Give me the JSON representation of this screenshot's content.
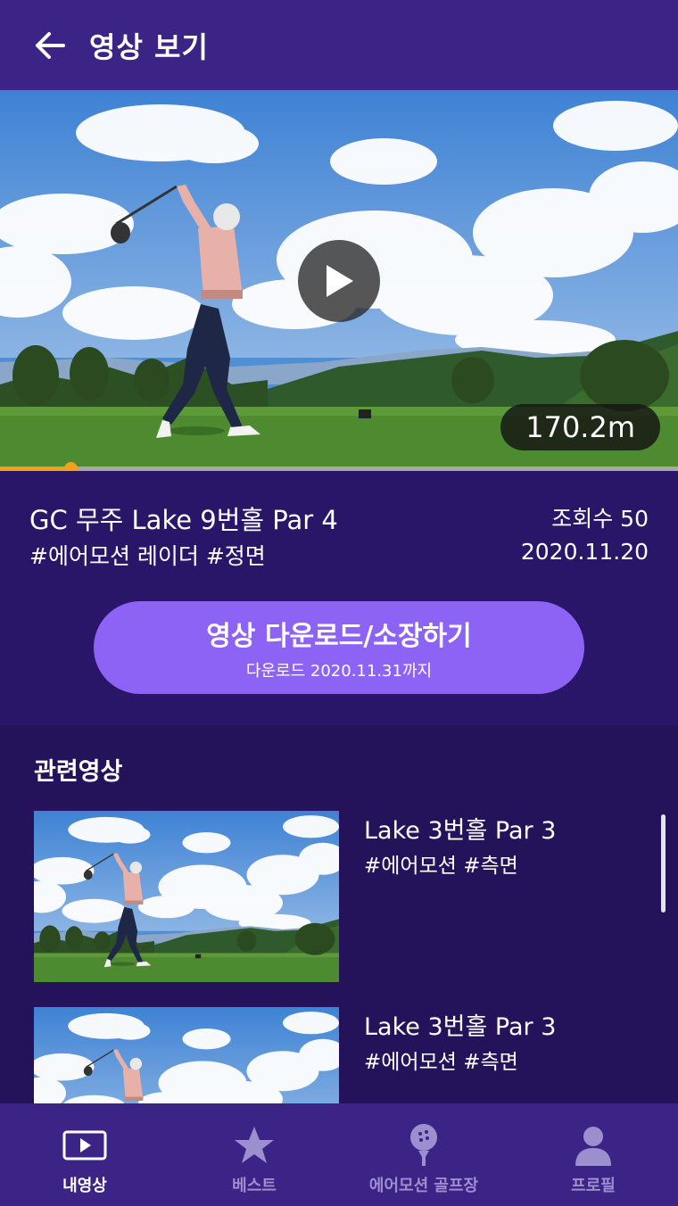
{
  "header": {
    "title": "영상 보기",
    "back_icon": "arrow-left-icon"
  },
  "video": {
    "distance": "170.2m",
    "progress_fraction": 0.104
  },
  "info": {
    "title": "GC 무주  Lake 9번홀 Par 4",
    "tags": "#에어모션 레이더 #정면",
    "view_count": "조회수 50",
    "date": "2020.11.20"
  },
  "download": {
    "label": "영상 다운로드/소장하기",
    "sublabel": "다운로드 2020.11.31까지"
  },
  "related": {
    "title": "관련영상",
    "items": [
      {
        "name": "Lake 3번홀  Par 3",
        "tags": "#에어모션 #측면"
      },
      {
        "name": "Lake 3번홀  Par 3",
        "tags": "#에어모션 #측면"
      }
    ]
  },
  "nav": {
    "items": [
      {
        "label": "내영상",
        "icon": "video-icon",
        "active": true
      },
      {
        "label": "베스트",
        "icon": "star-icon",
        "active": false
      },
      {
        "label": "에어모션 골프장",
        "icon": "golf-ball-icon",
        "active": false
      },
      {
        "label": "프로필",
        "icon": "person-icon",
        "active": false
      }
    ]
  },
  "colors": {
    "header_bg": "#3b2486",
    "body_bg": "#2a1668",
    "related_bg": "#24135a",
    "accent_button": "#8d63f5",
    "progress": "#f0a21a",
    "nav_inactive": "#9c8fcf"
  }
}
